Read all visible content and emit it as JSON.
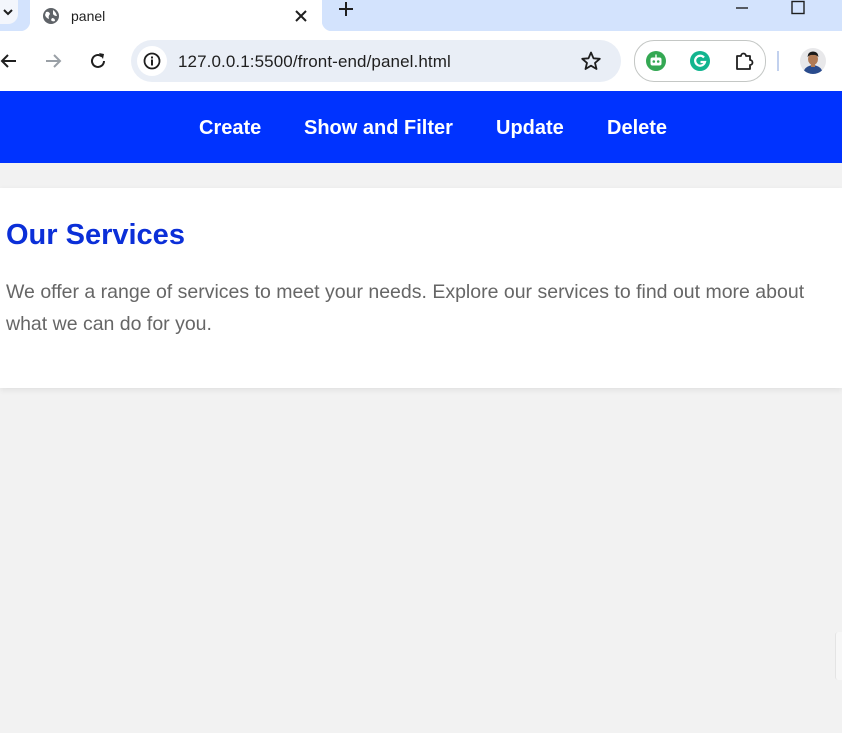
{
  "browser": {
    "tab": {
      "title": "panel"
    },
    "address": {
      "url": "127.0.0.1:5500/front-end/panel.html"
    },
    "icons": {
      "favicon": "globe-icon",
      "close": "close-icon",
      "new_tab": "plus-icon",
      "minimize": "minimize-icon",
      "maximize": "maximize-icon",
      "back": "back-arrow-icon",
      "forward": "forward-arrow-icon",
      "reload": "reload-icon",
      "site_info": "info-icon",
      "bookmark": "star-icon",
      "extensions": [
        "robot-extension-icon",
        "grammarly-icon",
        "puzzle-extensions-icon"
      ],
      "profile": "avatar"
    }
  },
  "navbar": {
    "links": [
      "Create",
      "Show and Filter",
      "Update",
      "Delete"
    ]
  },
  "services": {
    "heading": "Our Services",
    "text": "We offer a range of services to meet your needs. Explore our services to find out more about what we can do for you."
  },
  "colors": {
    "navbar_bg": "#0033ff",
    "heading": "#0b2fd8",
    "body_text": "#666666",
    "page_bg": "#f2f2f2",
    "tabstrip_bg": "#d3e3fd"
  }
}
